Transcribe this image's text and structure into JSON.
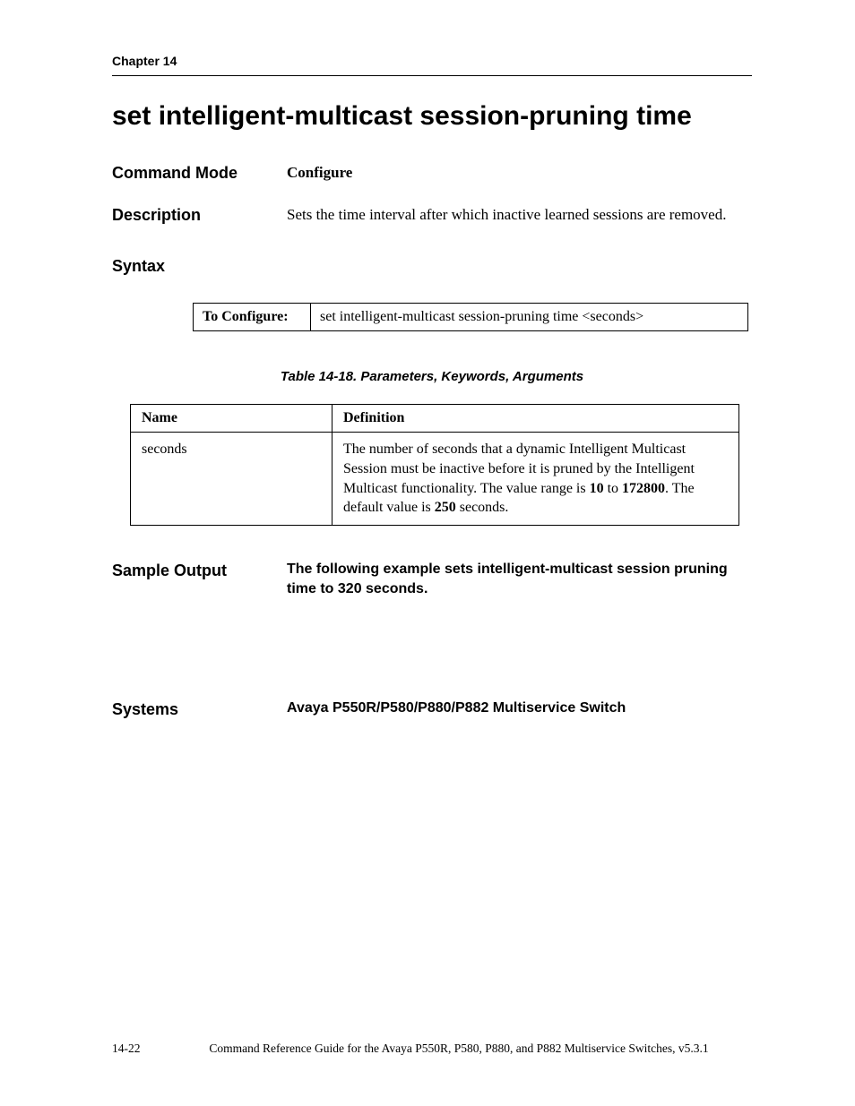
{
  "header": {
    "chapter": "Chapter 14"
  },
  "title": "set intelligent-multicast session-pruning time",
  "sections": {
    "command_mode": {
      "label": "Command Mode",
      "value": "Configure"
    },
    "description": {
      "label": "Description",
      "value": "Sets the time interval after which inactive learned sessions are removed."
    },
    "syntax": {
      "label": "Syntax",
      "to_configure_label": "To Configure:",
      "to_configure_value": "set intelligent-multicast session-pruning time <seconds>"
    },
    "param_table": {
      "caption": "Table 14-18.  Parameters, Keywords, Arguments",
      "headers": {
        "name": "Name",
        "definition": "Definition"
      },
      "rows": [
        {
          "name": "seconds",
          "definition_pre": "The number of seconds that a dynamic Intelligent Multicast Session must be inactive before it is pruned by the Intelligent Multicast functionality. The value range is ",
          "bold1": "10",
          "mid1": " to ",
          "bold2": "172800",
          "mid2": ". The default value is ",
          "bold3": "250",
          "post": " seconds."
        }
      ]
    },
    "sample_output": {
      "label": "Sample Output",
      "value": "The following example sets intelligent-multicast session pruning time to 320 seconds."
    },
    "systems": {
      "label": "Systems",
      "value": "Avaya P550R/P580/P880/P882 Multiservice Switch"
    }
  },
  "footer": {
    "page": "14-22",
    "doc": "Command Reference Guide for the Avaya P550R, P580, P880, and P882 Multiservice Switches, v5.3.1"
  }
}
